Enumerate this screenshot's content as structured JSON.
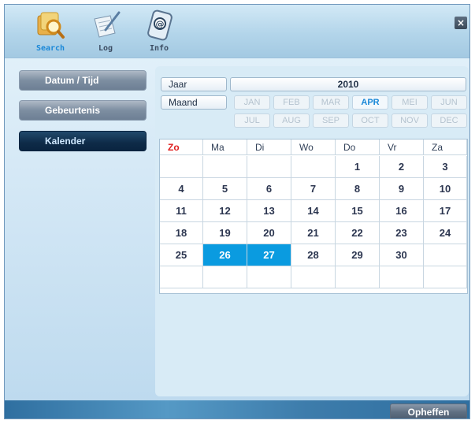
{
  "toolbar": {
    "tools": [
      {
        "label": "Search",
        "icon": "search-icon"
      },
      {
        "label": "Log",
        "icon": "log-icon"
      },
      {
        "label": "Info",
        "icon": "info-icon"
      }
    ],
    "close": "×"
  },
  "nav": {
    "items": [
      "Datum / Tijd",
      "Gebeurtenis",
      "Kalender"
    ]
  },
  "selectors": {
    "year_label": "Jaar",
    "year_value": "2010",
    "month_label": "Maand",
    "months": [
      "JAN",
      "FEB",
      "MAR",
      "APR",
      "MEI",
      "JUN",
      "JUL",
      "AUG",
      "SEP",
      "OCT",
      "NOV",
      "DEC"
    ],
    "selected_month": "APR"
  },
  "calendar": {
    "weekdays": [
      "Zo",
      "Ma",
      "Di",
      "Wo",
      "Do",
      "Vr",
      "Za"
    ],
    "weeks": [
      [
        "",
        "",
        "",
        "",
        "1",
        "2",
        "3"
      ],
      [
        "4",
        "5",
        "6",
        "7",
        "8",
        "9",
        "10"
      ],
      [
        "11",
        "12",
        "13",
        "14",
        "15",
        "16",
        "17"
      ],
      [
        "18",
        "19",
        "20",
        "21",
        "22",
        "23",
        "24"
      ],
      [
        "25",
        "26",
        "27",
        "28",
        "29",
        "30",
        ""
      ],
      [
        "",
        "",
        "",
        "",
        "",
        "",
        ""
      ]
    ],
    "highlighted_days": [
      "26",
      "27"
    ]
  },
  "footer": {
    "ok_label": "Opheffen"
  },
  "colors": {
    "accent": "#0a9be0",
    "sunday": "#e02020",
    "nav_active": "#0e2b48"
  }
}
